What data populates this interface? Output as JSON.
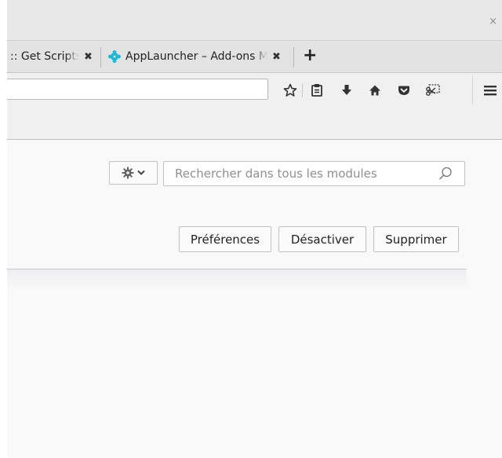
{
  "window": {
    "close_glyph": "×"
  },
  "tabs": [
    {
      "title": ":: Get Scripts",
      "close_glyph": "✖",
      "active": false
    },
    {
      "title": "AppLauncher – Add-ons Manager",
      "close_glyph": "✖",
      "active": true,
      "favicon": "puzzle-piece-icon"
    }
  ],
  "new_tab_glyph": "+",
  "toolbar": {
    "url_value": "",
    "icons": [
      "star-icon",
      "reading-list-icon",
      "download-icon",
      "home-icon",
      "pocket-icon",
      "screenshot-icon",
      "hamburger-menu-icon"
    ]
  },
  "addons": {
    "search": {
      "placeholder": "Rechercher dans tous les modules",
      "value": ""
    },
    "gear_menu_icon": "gear-icon",
    "buttons": {
      "preferences": "Préférences",
      "disable": "Désactiver",
      "remove": "Supprimer"
    }
  },
  "colors": {
    "favicon": "#20b9d3",
    "chrome": "#e3e3e3",
    "content_bg": "#f9f9fa"
  }
}
